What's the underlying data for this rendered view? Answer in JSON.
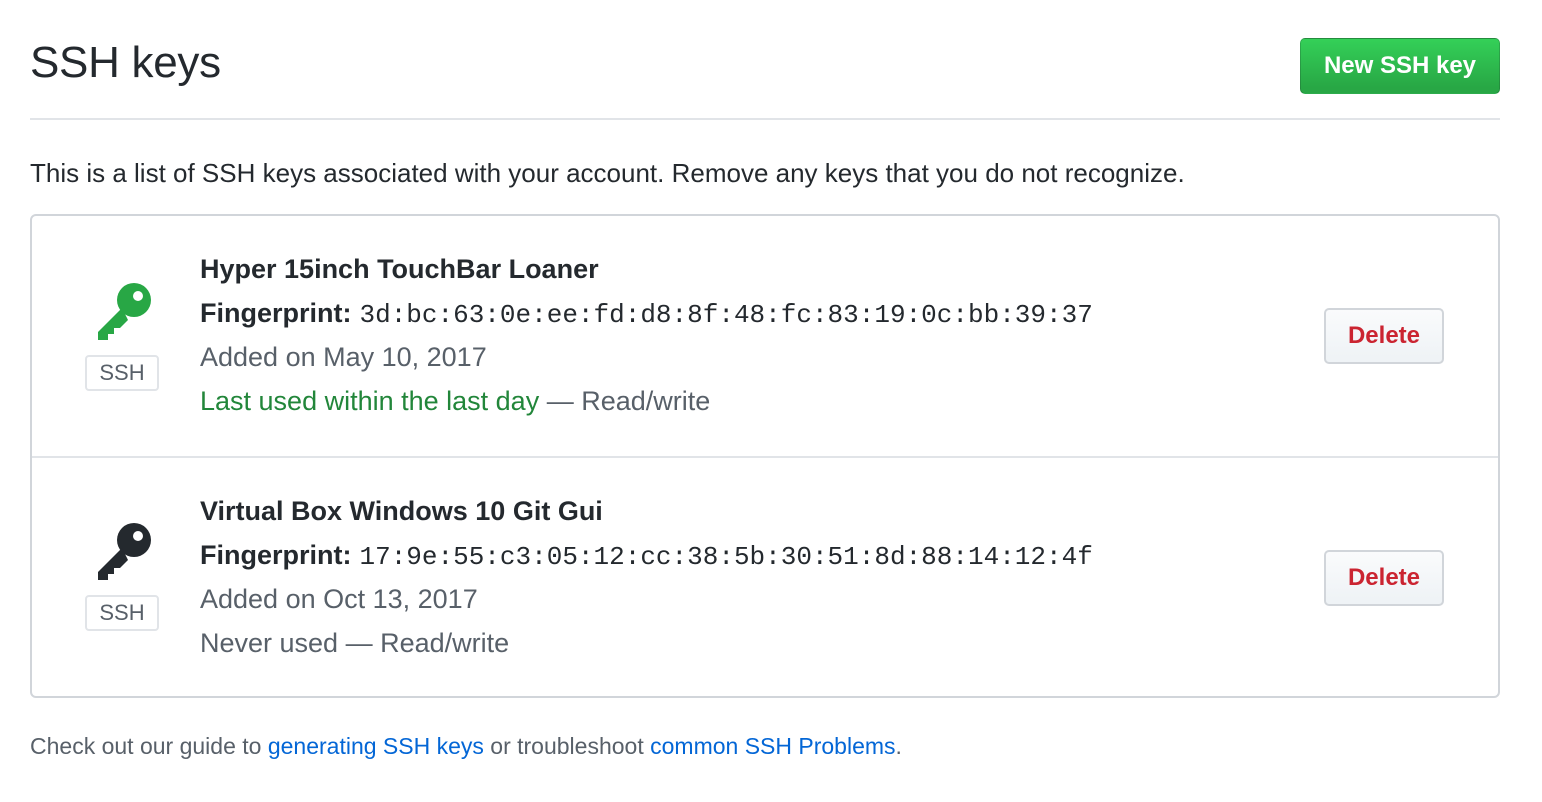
{
  "header": {
    "title": "SSH keys",
    "new_key_button": "New SSH key"
  },
  "intro_text": "This is a list of SSH keys associated with your account. Remove any keys that you do not recognize.",
  "keys": [
    {
      "title": "Hyper 15inch TouchBar Loaner",
      "fingerprint_label": "Fingerprint:",
      "fingerprint": "3d:bc:63:0e:ee:fd:d8:8f:48:fc:83:19:0c:bb:39:37",
      "added": "Added on May 10, 2017",
      "last_used": "Last used within the last day",
      "access": " — Read/write",
      "type_label": "SSH",
      "icon": "key-icon",
      "icon_color": "#28a745",
      "delete_label": "Delete"
    },
    {
      "title": "Virtual Box Windows 10 Git Gui",
      "fingerprint_label": "Fingerprint:",
      "fingerprint": "17:9e:55:c3:05:12:cc:38:5b:30:51:8d:88:14:12:4f",
      "added": "Added on Oct 13, 2017",
      "last_used": "Never used",
      "access": " — Read/write",
      "type_label": "SSH",
      "icon": "key-icon",
      "icon_color": "#24292e",
      "delete_label": "Delete"
    }
  ],
  "footer": {
    "prefix": "Check out our guide to ",
    "link1": "generating SSH keys",
    "middle": " or troubleshoot ",
    "link2": "common SSH Problems",
    "suffix": "."
  },
  "colors": {
    "primary_button": "#28a745",
    "danger": "#cb2431",
    "link": "#0366d6",
    "recent_usage": "#22863a"
  }
}
